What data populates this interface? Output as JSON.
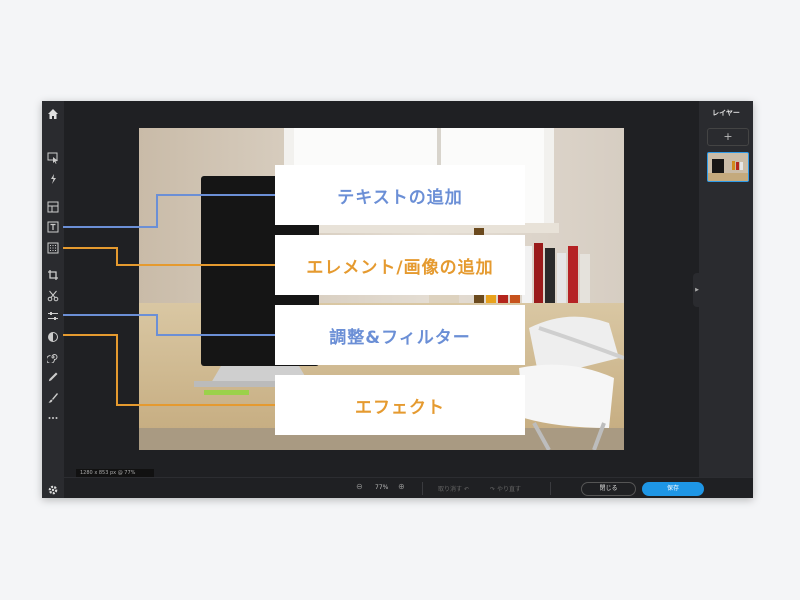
{
  "toolbar": {
    "tools": [
      {
        "icon": "home-icon"
      },
      {
        "icon": "select-icon"
      },
      {
        "icon": "magic-wand-icon"
      },
      {
        "icon": "layout-icon"
      },
      {
        "icon": "text-tool-icon"
      },
      {
        "icon": "element-grid-icon"
      },
      {
        "icon": "crop-icon"
      },
      {
        "icon": "cut-icon"
      },
      {
        "icon": "adjust-sliders-icon"
      },
      {
        "icon": "effects-icon"
      },
      {
        "icon": "spiral-icon"
      },
      {
        "icon": "pencil-icon"
      },
      {
        "icon": "brush-icon"
      },
      {
        "icon": "more-icon"
      },
      {
        "icon": "settings-icon"
      }
    ]
  },
  "canvas": {
    "dimensions_label": "1280 x 853 px @ 77%"
  },
  "layers": {
    "title": "レイヤー",
    "add_label": "+"
  },
  "bottombar": {
    "zoom": "77%",
    "undo": "取り消す",
    "redo": "やり直す",
    "close": "閉じる",
    "save": "保存"
  },
  "callouts": [
    {
      "label": "テキストの追加",
      "color": "#6b8fd6"
    },
    {
      "label": "エレメント/画像の追加",
      "color": "#e59a2f"
    },
    {
      "label": "調整&フィルター",
      "color": "#6b8fd6"
    },
    {
      "label": "エフェクト",
      "color": "#e59a2f"
    }
  ],
  "colors": {
    "accent_blue": "#1e96e6",
    "callout_blue": "#6b8fd6",
    "callout_orange": "#e59a2f"
  }
}
